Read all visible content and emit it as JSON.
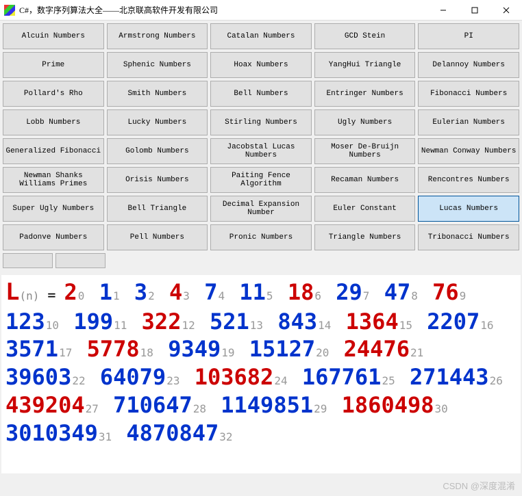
{
  "window": {
    "title": "C#，数字序列算法大全——北京联高软件开发有限公司"
  },
  "buttons": [
    [
      "Alcuin Numbers",
      "Armstrong Numbers",
      "Catalan Numbers",
      "GCD Stein",
      "PI"
    ],
    [
      "Prime",
      "Sphenic Numbers",
      "Hoax Numbers",
      "YangHui Triangle",
      "Delannoy Numbers"
    ],
    [
      "Pollard's Rho",
      "Smith Numbers",
      "Bell Numbers",
      "Entringer Numbers",
      "Fibonacci Numbers"
    ],
    [
      "Lobb Numbers",
      "Lucky Numbers",
      "Stirling Numbers",
      "Ugly Numbers",
      "Eulerian Numbers"
    ],
    [
      "Generalized Fibonacci",
      "Golomb Numbers",
      "Jacobstal Lucas Numbers",
      "Moser De-Bruijn Numbers",
      "Newman Conway Numbers"
    ],
    [
      "Newman Shanks Williams Primes",
      "Orisis Numbers",
      "Paiting Fence Algorithm",
      "Recaman Numbers",
      "Rencontres Numbers"
    ],
    [
      "Super Ugly Numbers",
      "Bell Triangle",
      "Decimal Expansion Number",
      "Euler Constant",
      "Lucas Numbers"
    ],
    [
      "Padonve Numbers",
      "Pell Numbers",
      "Pronic Numbers",
      "Triangle Numbers",
      "Tribonacci Numbers"
    ]
  ],
  "selected": "Lucas Numbers",
  "sequence": {
    "symbol": "L",
    "argLabel": "(n)",
    "eq": " = ",
    "terms": [
      {
        "i": 0,
        "v": "2",
        "c": "red"
      },
      {
        "i": 1,
        "v": "1",
        "c": "blue"
      },
      {
        "i": 2,
        "v": "3",
        "c": "blue"
      },
      {
        "i": 3,
        "v": "4",
        "c": "red"
      },
      {
        "i": 4,
        "v": "7",
        "c": "blue"
      },
      {
        "i": 5,
        "v": "11",
        "c": "blue"
      },
      {
        "i": 6,
        "v": "18",
        "c": "red"
      },
      {
        "i": 7,
        "v": "29",
        "c": "blue"
      },
      {
        "i": 8,
        "v": "47",
        "c": "blue"
      },
      {
        "i": 9,
        "v": "76",
        "c": "red"
      },
      {
        "i": 10,
        "v": "123",
        "c": "blue"
      },
      {
        "i": 11,
        "v": "199",
        "c": "blue"
      },
      {
        "i": 12,
        "v": "322",
        "c": "red"
      },
      {
        "i": 13,
        "v": "521",
        "c": "blue"
      },
      {
        "i": 14,
        "v": "843",
        "c": "blue"
      },
      {
        "i": 15,
        "v": "1364",
        "c": "red"
      },
      {
        "i": 16,
        "v": "2207",
        "c": "blue"
      },
      {
        "i": 17,
        "v": "3571",
        "c": "blue"
      },
      {
        "i": 18,
        "v": "5778",
        "c": "red"
      },
      {
        "i": 19,
        "v": "9349",
        "c": "blue"
      },
      {
        "i": 20,
        "v": "15127",
        "c": "blue"
      },
      {
        "i": 21,
        "v": "24476",
        "c": "red"
      },
      {
        "i": 22,
        "v": "39603",
        "c": "blue"
      },
      {
        "i": 23,
        "v": "64079",
        "c": "blue"
      },
      {
        "i": 24,
        "v": "103682",
        "c": "red"
      },
      {
        "i": 25,
        "v": "167761",
        "c": "blue"
      },
      {
        "i": 26,
        "v": "271443",
        "c": "blue"
      },
      {
        "i": 27,
        "v": "439204",
        "c": "red"
      },
      {
        "i": 28,
        "v": "710647",
        "c": "blue"
      },
      {
        "i": 29,
        "v": "1149851",
        "c": "blue"
      },
      {
        "i": 30,
        "v": "1860498",
        "c": "red"
      },
      {
        "i": 31,
        "v": "3010349",
        "c": "blue"
      },
      {
        "i": 32,
        "v": "4870847",
        "c": "blue"
      }
    ]
  },
  "watermark": "CSDN @深度混淆"
}
